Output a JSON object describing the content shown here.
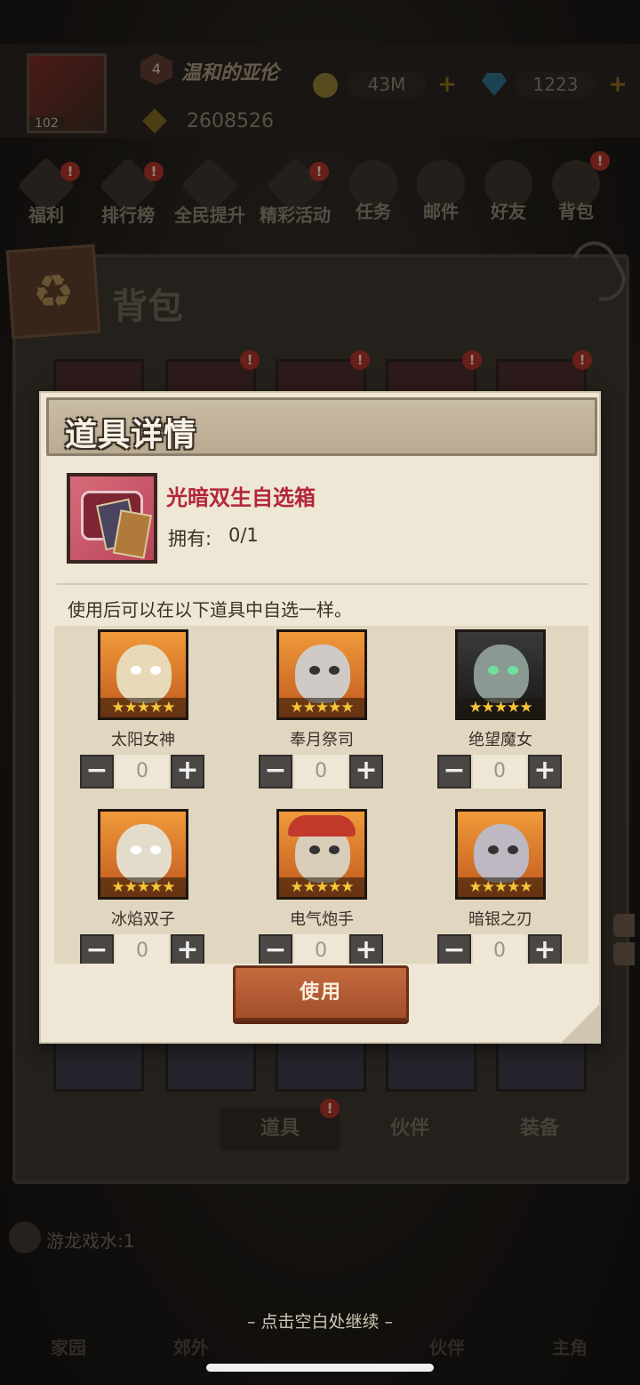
{
  "background": {
    "player": {
      "level": "102",
      "vip": "4",
      "name": "温和的亚伦",
      "power": "2608526"
    },
    "currencies": [
      {
        "icon": "coin-icon",
        "value": "43M"
      },
      {
        "icon": "gem-icon",
        "value": "1223"
      }
    ],
    "menu": [
      {
        "label": "福利",
        "badge": "!"
      },
      {
        "label": "排行榜",
        "badge": "!"
      },
      {
        "label": "全民提升",
        "badge": ""
      },
      {
        "label": "精彩活动",
        "badge": "!"
      },
      {
        "label": "任务",
        "badge": ""
      },
      {
        "label": "邮件",
        "badge": ""
      },
      {
        "label": "好友",
        "badge": ""
      },
      {
        "label": "背包",
        "badge": "!"
      }
    ],
    "bag": {
      "title": "背包",
      "tabs": [
        {
          "label": "道具",
          "badge": "!"
        },
        {
          "label": "伙伴"
        },
        {
          "label": "装备"
        }
      ]
    },
    "task": "游龙戏水:1",
    "nav": [
      "家园",
      "郊外",
      "",
      "伙伴",
      "主角"
    ]
  },
  "dialog": {
    "title": "道具详情",
    "item": {
      "name": "光暗双生自选箱",
      "own_label": "拥有:",
      "own_value": "0/1"
    },
    "description": "使用后可以在以下道具中自选一样。",
    "choices": [
      {
        "name": "太阳女神",
        "count": "0",
        "stars": "★★★★★"
      },
      {
        "name": "奉月祭司",
        "count": "0",
        "stars": "★★★★★"
      },
      {
        "name": "绝望魔女",
        "count": "0",
        "stars": "★★★★★"
      },
      {
        "name": "冰焰双子",
        "count": "0",
        "stars": "★★★★★"
      },
      {
        "name": "电气炮手",
        "count": "0",
        "stars": "★★★★★"
      },
      {
        "name": "暗银之刃",
        "count": "0",
        "stars": "★★★★★"
      }
    ],
    "minus_symbol": "−",
    "plus_symbol": "+",
    "use_button": "使用"
  },
  "hint": "–  点击空白处继续  –",
  "colors": {
    "item_name": "#b2263a",
    "use_button": "#b45c34",
    "dialog_bg": "#efe7d5"
  }
}
